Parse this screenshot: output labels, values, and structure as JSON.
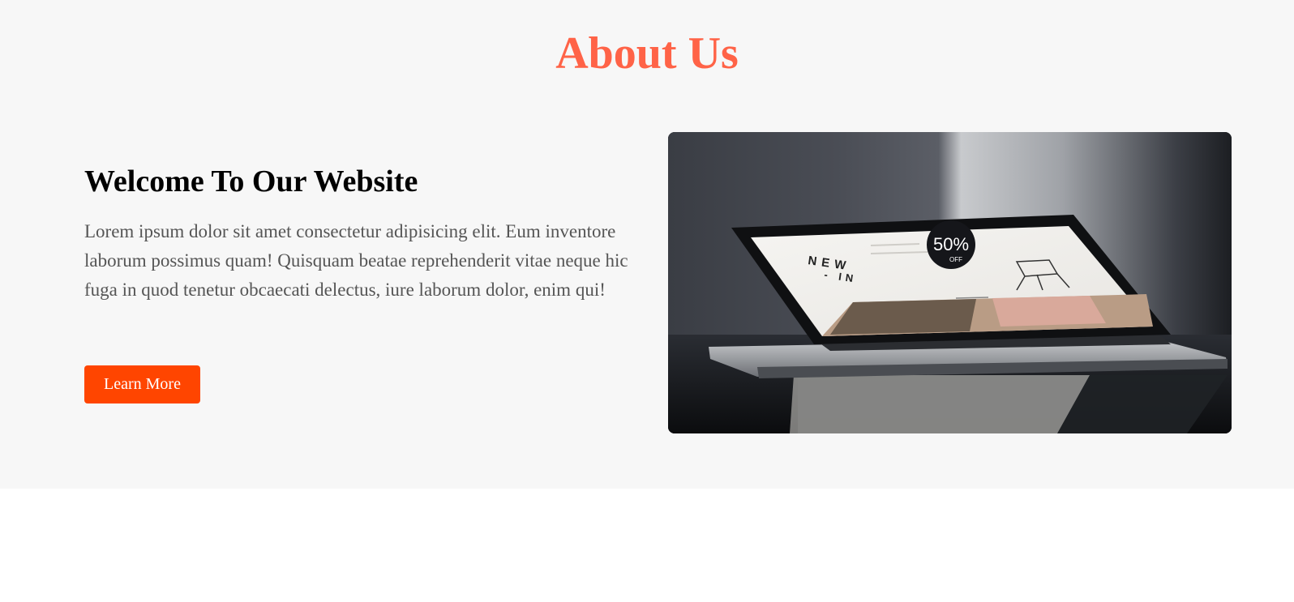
{
  "about": {
    "title": "About Us",
    "heading": "Welcome To Our Website",
    "paragraph": "Lorem ipsum dolor sit amet consectetur adipisicing elit. Eum inventore laborum possimus quam! Quisquam beatae reprehenderit vitae neque hic fuga in quod tenetur obcaecati delectus, iure laborum dolor, enim qui!",
    "button_label": "Learn More",
    "image": {
      "icon": "laptop-photo",
      "screen_text_line1": "NEW",
      "screen_text_line2": "- IN",
      "badge_text": "50%",
      "badge_sub": "OFF"
    }
  },
  "colors": {
    "title": "#ff6347",
    "button": "#ff4500",
    "section_bg": "#f7f7f7",
    "page_bg": "#ffffff"
  }
}
